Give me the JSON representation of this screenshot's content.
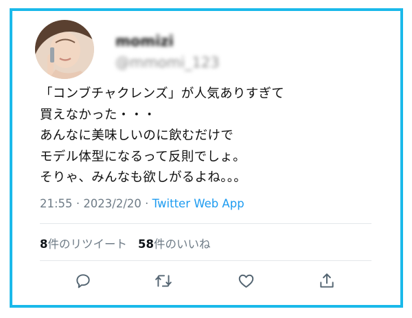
{
  "user": {
    "display_name": "momizi",
    "handle": "@mmomi_123"
  },
  "tweet": {
    "lines": [
      "「コンブチャクレンズ」が人気ありすぎて",
      "買えなかった・・・",
      "あんなに美味しいのに飲むだけで",
      "モデル体型になるって反則でしょ。",
      "そりゃ、みんなも欲しがるよね。。。"
    ],
    "time": "21:55",
    "date": "2023/2/20",
    "separator": "·",
    "source": "Twitter Web App"
  },
  "stats": {
    "retweets_count": "8",
    "retweets_label": "件のリツイート",
    "likes_count": "58",
    "likes_label": "件のいいね"
  },
  "actions": [
    "reply-icon",
    "retweet-icon",
    "like-icon",
    "share-icon"
  ],
  "colors": {
    "frame_border": "#1ab9ea",
    "link": "#1d9bf0",
    "secondary_text": "#6e7b86",
    "divider": "#e3e7ea"
  }
}
